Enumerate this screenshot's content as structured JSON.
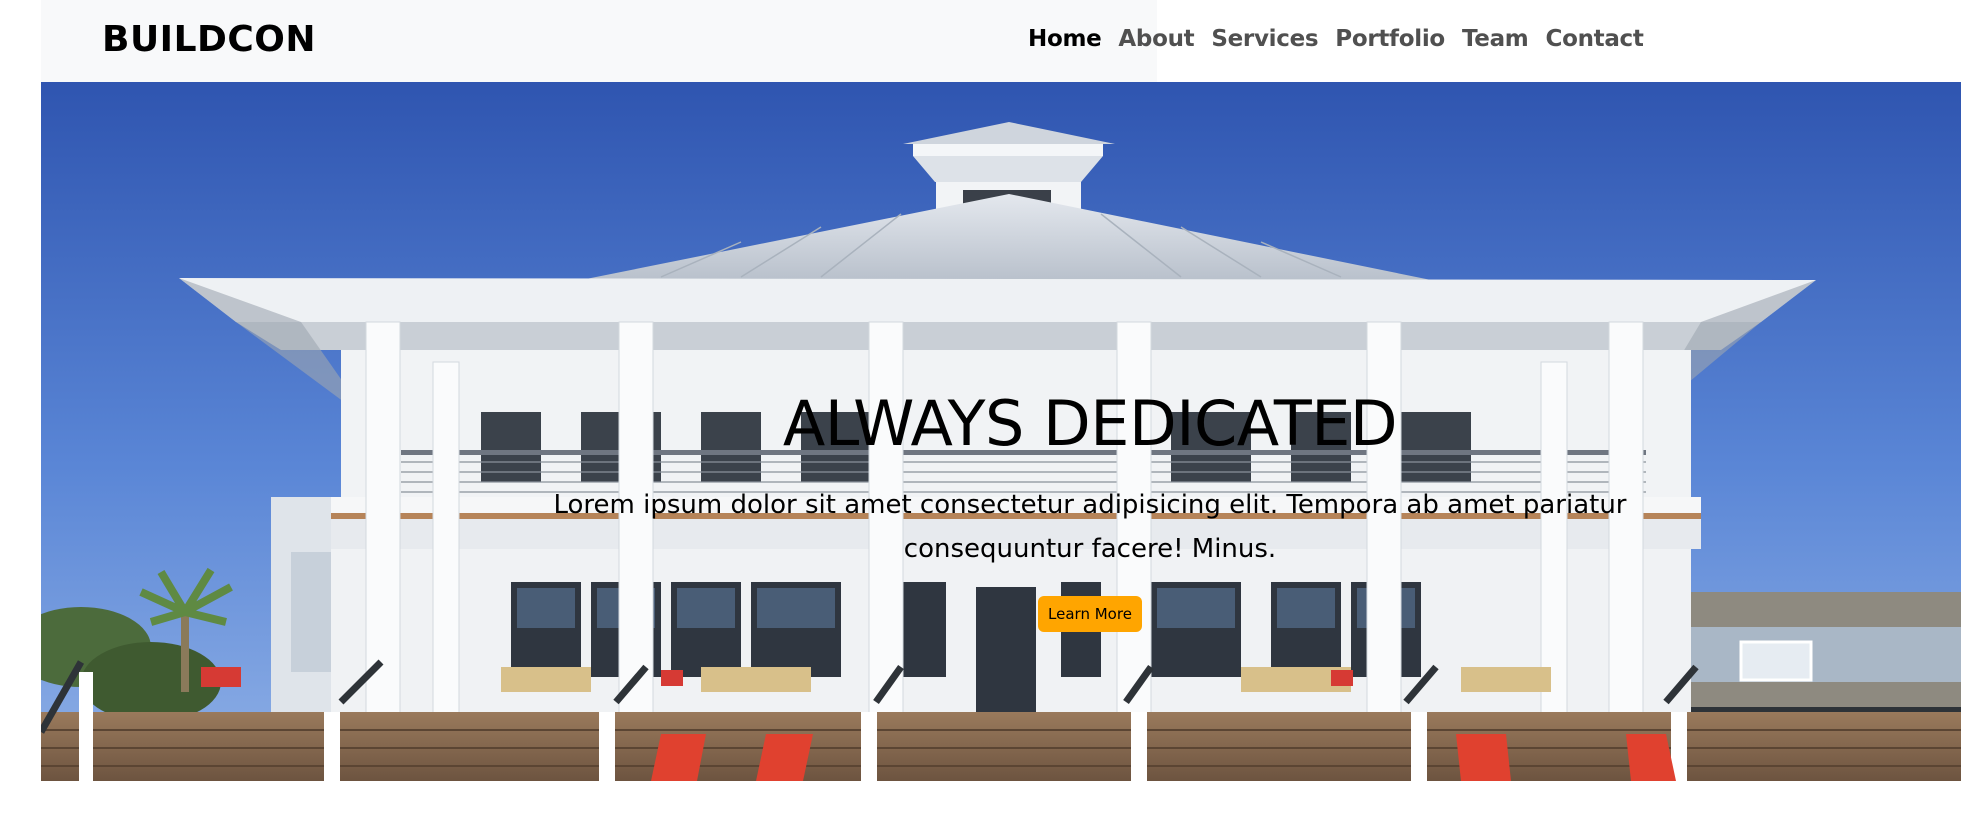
{
  "brand": {
    "name": "BUILDCON"
  },
  "nav": {
    "items": [
      {
        "label": "Home",
        "active": true
      },
      {
        "label": "About",
        "active": false
      },
      {
        "label": "Services",
        "active": false
      },
      {
        "label": "Portfolio",
        "active": false
      },
      {
        "label": "Team",
        "active": false
      },
      {
        "label": "Contact",
        "active": false
      }
    ]
  },
  "hero": {
    "title": "ALWAYS DEDICATED",
    "text": "Lorem ipsum dolor sit amet consectetur adipisicing elit. Tempora ab amet pariatur consequuntur facere! Minus.",
    "button_label": "Learn More"
  },
  "colors": {
    "accent": "#ffa500",
    "navbar_bg": "#f8f9fa",
    "sky": "#3f67bf"
  }
}
